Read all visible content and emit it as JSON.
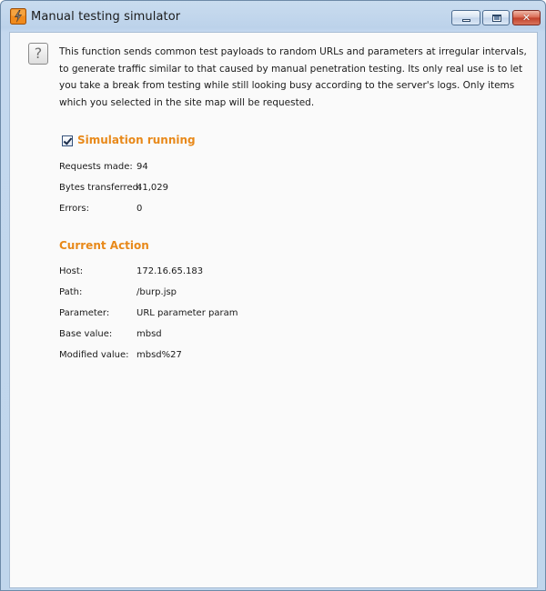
{
  "window": {
    "title": "Manual testing simulator",
    "controls": {
      "minimize": "minimize",
      "maximize": "maximize",
      "close": "✕"
    }
  },
  "help": {
    "glyph": "?"
  },
  "description": "This function sends common test payloads to random URLs and parameters at irregular intervals, to generate traffic similar to that caused by manual penetration testing. Its only real use is to let you take a break from testing while still looking busy according to the server's logs. Only items which you selected in the site map will be requested.",
  "simulation": {
    "checked": true,
    "heading": "Simulation running",
    "stats": [
      {
        "label": "Requests made:",
        "value": "94"
      },
      {
        "label": "Bytes transferred:",
        "value": "41,029"
      },
      {
        "label": "Errors:",
        "value": "0"
      }
    ]
  },
  "current_action": {
    "heading": "Current Action",
    "fields": [
      {
        "label": "Host:",
        "value": "172.16.65.183"
      },
      {
        "label": "Path:",
        "value": "/burp.jsp"
      },
      {
        "label": "Parameter:",
        "value": "URL parameter param"
      },
      {
        "label": "Base value:",
        "value": "mbsd"
      },
      {
        "label": "Modified value:",
        "value": "mbsd%27"
      }
    ]
  },
  "colors": {
    "heading_accent": "#e8891a",
    "titlebar": "#c9dcef",
    "close_button": "#c0402a"
  },
  "icons": {
    "app": "burp-lightning-icon",
    "help": "question-mark-icon",
    "checkbox": "checkbox-checked-icon"
  }
}
